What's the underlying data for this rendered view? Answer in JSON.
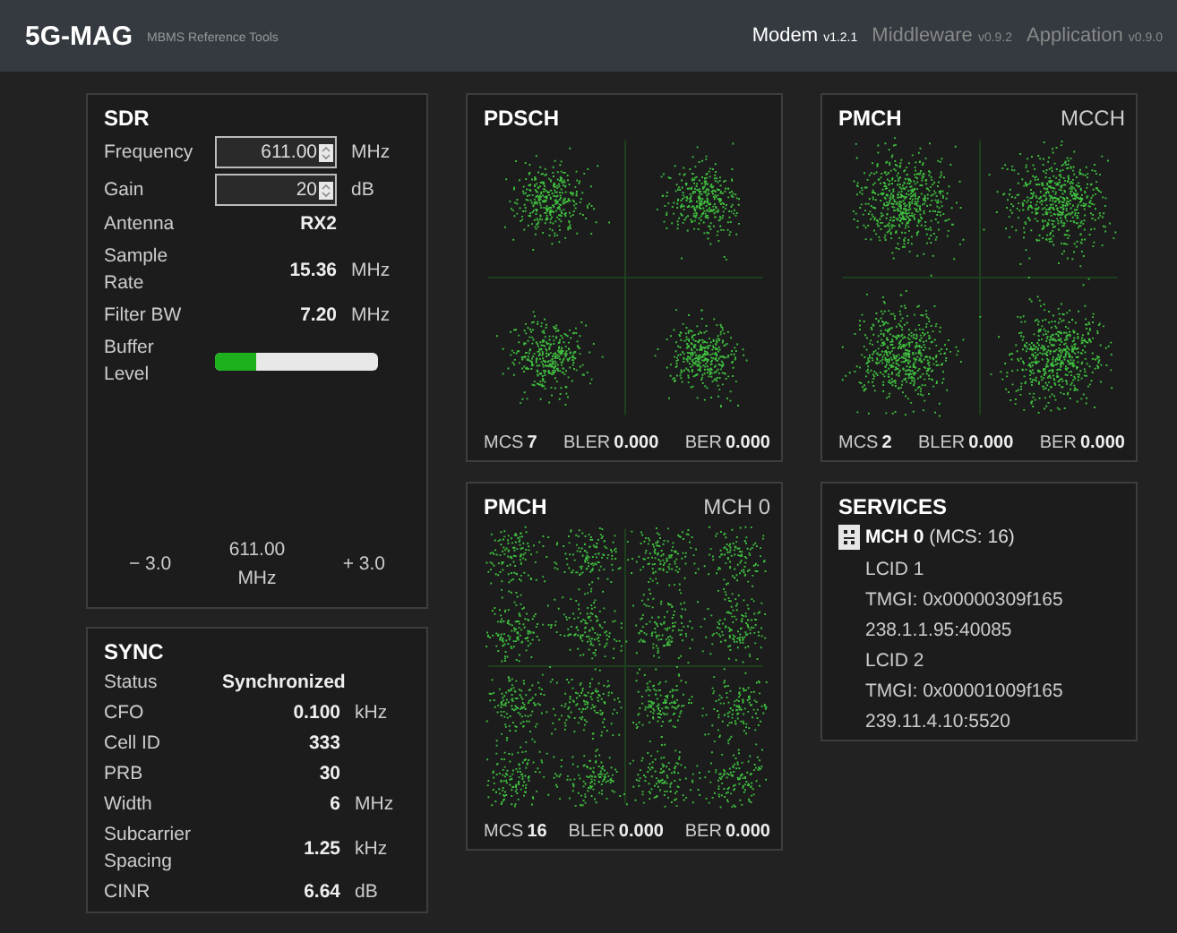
{
  "header": {
    "logo": "5G-MAG",
    "subtitle": "MBMS Reference Tools",
    "nav": [
      {
        "name": "Modem",
        "version": "v1.2.1",
        "selected": true
      },
      {
        "name": "Middleware",
        "version": "v0.9.2",
        "selected": false
      },
      {
        "name": "Application",
        "version": "v0.9.0",
        "selected": false
      }
    ]
  },
  "sdr": {
    "title": "SDR",
    "rows": [
      {
        "kind": "input",
        "label": "Frequency",
        "value": "611.00",
        "unit": "MHz"
      },
      {
        "kind": "input",
        "label": "Gain",
        "value": "20",
        "unit": "dB"
      },
      {
        "kind": "value",
        "label": "Antenna",
        "value": "RX2"
      },
      {
        "kind": "value",
        "label": "Sample Rate",
        "value": "15.36",
        "unit": "MHz"
      },
      {
        "kind": "value",
        "label": "Filter BW",
        "value": "7.20",
        "unit": "MHz"
      },
      {
        "kind": "bar",
        "label": "Buffer Level",
        "level": 0.25
      }
    ],
    "spectrum": {
      "left": "− 3.0",
      "center": "611.00 MHz",
      "right": "+ 3.0"
    }
  },
  "sync": {
    "title": "SYNC",
    "rows": [
      {
        "label": "Status",
        "value": "Synchronized"
      },
      {
        "label": "CFO",
        "value": "0.100",
        "unit": "kHz"
      },
      {
        "label": "Cell ID",
        "value": "333"
      },
      {
        "label": "PRB",
        "value": "30"
      },
      {
        "label": "Width",
        "value": "6",
        "unit": "MHz"
      },
      {
        "label": "Subcarrier Spacing",
        "value": "1.25",
        "unit": "kHz"
      },
      {
        "label": "CINR",
        "value": "6.64",
        "unit": "dB"
      }
    ]
  },
  "plots": [
    {
      "title": "PDSCH",
      "kind": "qpsk",
      "stats": [
        {
          "label": "MCS",
          "value": "7"
        },
        {
          "label": "BLER",
          "value": "0.000"
        },
        {
          "label": "BER",
          "value": "0.000"
        }
      ]
    },
    {
      "title": "PMCH",
      "subtitle": "MCCH",
      "kind": "qpsk",
      "stats": [
        {
          "label": "MCS",
          "value": "2"
        },
        {
          "label": "BLER",
          "value": "0.000"
        },
        {
          "label": "BER",
          "value": "0.000"
        }
      ]
    },
    {
      "title": "PMCH",
      "subtitle": "MCH 0",
      "kind": "qam16",
      "stats": [
        {
          "label": "MCS",
          "value": "16"
        },
        {
          "label": "BLER",
          "value": "0.000"
        },
        {
          "label": "BER",
          "value": "0.000"
        }
      ]
    }
  ],
  "services": {
    "title": "SERVICES",
    "mchs": [
      {
        "name": "MCH 0",
        "detail": "(MCS: 16)",
        "lcids": [
          {
            "label": "LCID 1",
            "tmgi": "TMGI: 0x00000309f165",
            "address": "238.1.1.95:40085"
          },
          {
            "label": "LCID 2",
            "tmgi": "TMGI: 0x00001009f165",
            "address": "239.11.4.10:5520"
          }
        ]
      }
    ]
  }
}
